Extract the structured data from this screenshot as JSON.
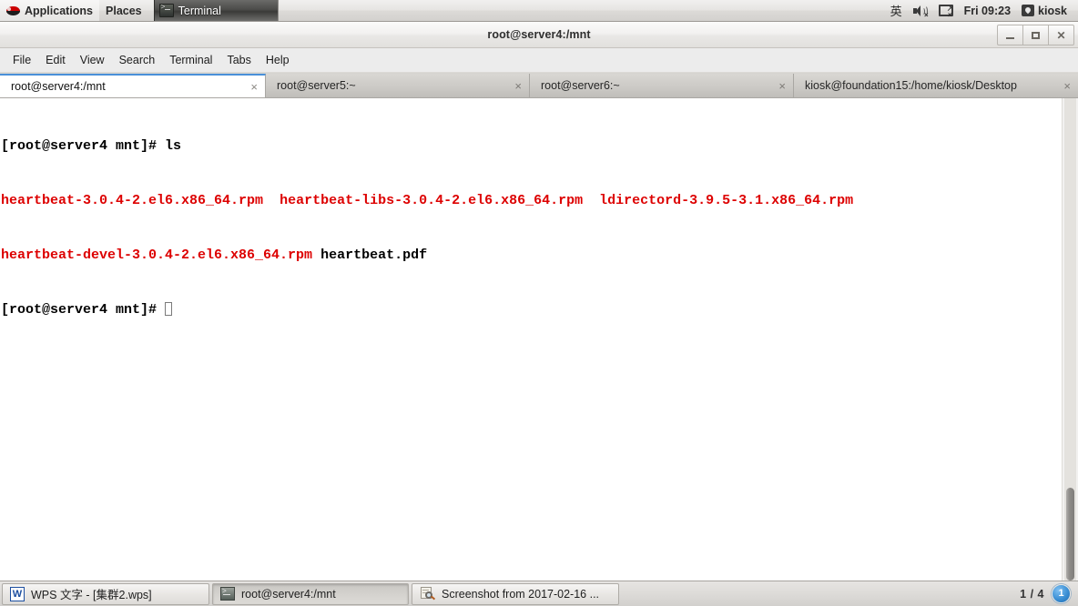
{
  "top_panel": {
    "applications_label": "Applications",
    "places_label": "Places",
    "window_list": [
      {
        "title": "Terminal",
        "icon": "terminal-icon",
        "active": true
      }
    ],
    "tray": {
      "input_method": "英",
      "volume_icon": "speaker-muted-icon",
      "network_icon": "network-display-disconnected-icon",
      "clock": "Fri 09:23",
      "user_icon": "user-icon",
      "user_name": "kiosk"
    }
  },
  "window": {
    "title": "root@server4:/mnt",
    "buttons": {
      "minimize": "minimize-button",
      "maximize": "maximize-button",
      "close": "close-button"
    },
    "menubar": [
      "File",
      "Edit",
      "View",
      "Search",
      "Terminal",
      "Tabs",
      "Help"
    ],
    "tabs": [
      {
        "label": "root@server4:/mnt",
        "active": true,
        "close": "×"
      },
      {
        "label": "root@server5:~",
        "active": false,
        "close": "×"
      },
      {
        "label": "root@server6:~",
        "active": false,
        "close": "×"
      },
      {
        "label": "kiosk@foundation15:/home/kiosk/Desktop",
        "active": false,
        "close": "×"
      }
    ]
  },
  "terminal": {
    "prompt": "[root@server4 mnt]# ",
    "command": "ls",
    "listing_rows": [
      [
        {
          "text": "heartbeat-3.0.4-2.el6.x86_64.rpm",
          "color": "red"
        },
        {
          "text": "heartbeat-libs-3.0.4-2.el6.x86_64.rpm",
          "color": "red"
        },
        {
          "text": "ldirectord-3.9.5-3.1.x86_64.rpm",
          "color": "red"
        }
      ],
      [
        {
          "text": "heartbeat-devel-3.0.4-2.el6.x86_64.rpm",
          "color": "red"
        },
        {
          "text": "heartbeat.pdf",
          "color": "normal"
        }
      ]
    ],
    "prompt_line_2": "[root@server4 mnt]# ",
    "cursor": "block-cursor",
    "colors": {
      "foreground": "#000000",
      "background": "#ffffff",
      "red": "#dd0000"
    }
  },
  "bottom_panel": {
    "tasks": [
      {
        "label": "WPS 文字 - [集群2.wps]",
        "icon": "wps-icon",
        "active": false
      },
      {
        "label": "root@server4:/mnt",
        "icon": "terminal-icon",
        "active": true
      },
      {
        "label": "Screenshot from 2017-02-16 ...",
        "icon": "screenshot-icon",
        "active": false
      }
    ],
    "workspace_count": "1 / 4",
    "workspace_indicator": "1"
  }
}
